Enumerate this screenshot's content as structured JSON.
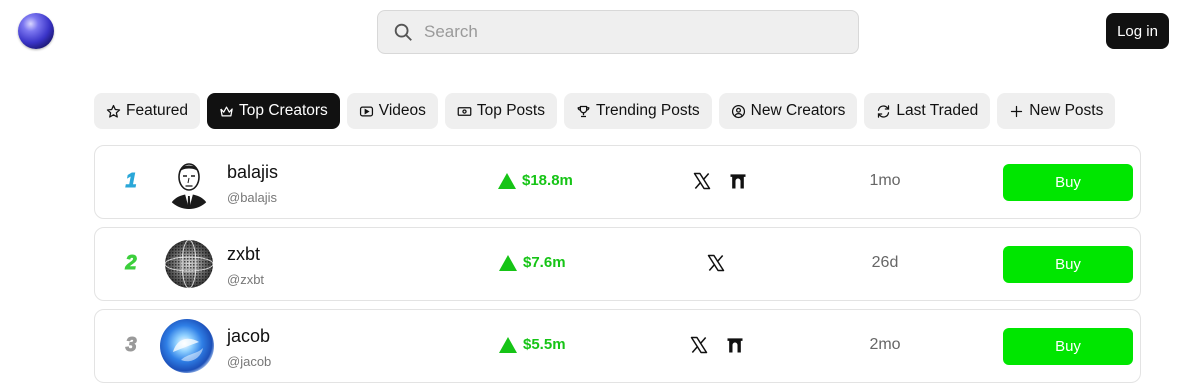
{
  "header": {
    "search": {
      "placeholder": "Search",
      "value": ""
    },
    "login_label": "Log in"
  },
  "tabs": [
    {
      "label": "Featured",
      "icon": "star-icon",
      "active": false
    },
    {
      "label": "Top Creators",
      "icon": "crown-icon",
      "active": true
    },
    {
      "label": "Videos",
      "icon": "play-icon",
      "active": false
    },
    {
      "label": "Top Posts",
      "icon": "money-icon",
      "active": false
    },
    {
      "label": "Trending Posts",
      "icon": "trophy-icon",
      "active": false
    },
    {
      "label": "New Creators",
      "icon": "user-circle-icon",
      "active": false
    },
    {
      "label": "Last Traded",
      "icon": "refresh-icon",
      "active": false
    },
    {
      "label": "New Posts",
      "icon": "plus-icon",
      "active": false
    }
  ],
  "creators": [
    {
      "rank": "1",
      "name": "balajis",
      "handle": "@balajis",
      "change": "$18.8m",
      "socials": [
        "x-icon",
        "arch-icon"
      ],
      "age": "1mo",
      "buy_label": "Buy",
      "rank_color": "#2aa7d8"
    },
    {
      "rank": "2",
      "name": "zxbt",
      "handle": "@zxbt",
      "change": "$7.6m",
      "socials": [
        "x-icon"
      ],
      "age": "26d",
      "buy_label": "Buy",
      "rank_color": "#3ccf3c"
    },
    {
      "rank": "3",
      "name": "jacob",
      "handle": "@jacob",
      "change": "$5.5m",
      "socials": [
        "x-icon",
        "arch-icon"
      ],
      "age": "2mo",
      "buy_label": "Buy",
      "rank_color": "#9a9a9a"
    }
  ],
  "colors": {
    "accent_green": "#00e600",
    "change_green": "#16c416",
    "dark": "#111111"
  }
}
